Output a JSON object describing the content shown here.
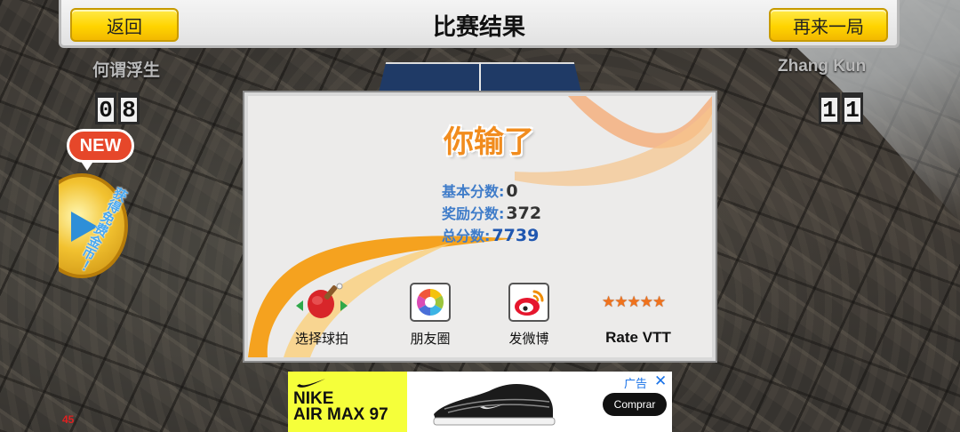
{
  "topbar": {
    "back_label": "返回",
    "title": "比赛结果",
    "again_label": "再来一局"
  },
  "players": {
    "left": {
      "name": "何谓浮生",
      "score_digits": [
        "0",
        "8"
      ]
    },
    "right": {
      "name": "Zhang Kun",
      "score_digits": [
        "1",
        "1"
      ]
    }
  },
  "promo": {
    "new_badge": "NEW",
    "side_text": "获得免费金币！"
  },
  "result": {
    "title": "你输了",
    "base_label": "基本分数",
    "base_value": "0",
    "bonus_label": "奖励分数",
    "bonus_value": "372",
    "total_label": "总分数",
    "total_value": "7739",
    "colon": ":"
  },
  "actions": {
    "racket_label": "选择球拍",
    "moments_label": "朋友圈",
    "weibo_label": "发微博",
    "rate_label": "Rate VTT",
    "rate_stars": 5
  },
  "ad": {
    "brand_line1": "NIKE",
    "brand_line2": "AIR MAX 97",
    "tag": "广告",
    "close": "✕",
    "cta": "Comprar"
  },
  "debug": {
    "fps": "45"
  },
  "colors": {
    "accent_yellow": "#ffd400",
    "lose_orange": "#f18c1e",
    "score_blue": "#3f7cc9",
    "total_blue": "#2057b0"
  }
}
